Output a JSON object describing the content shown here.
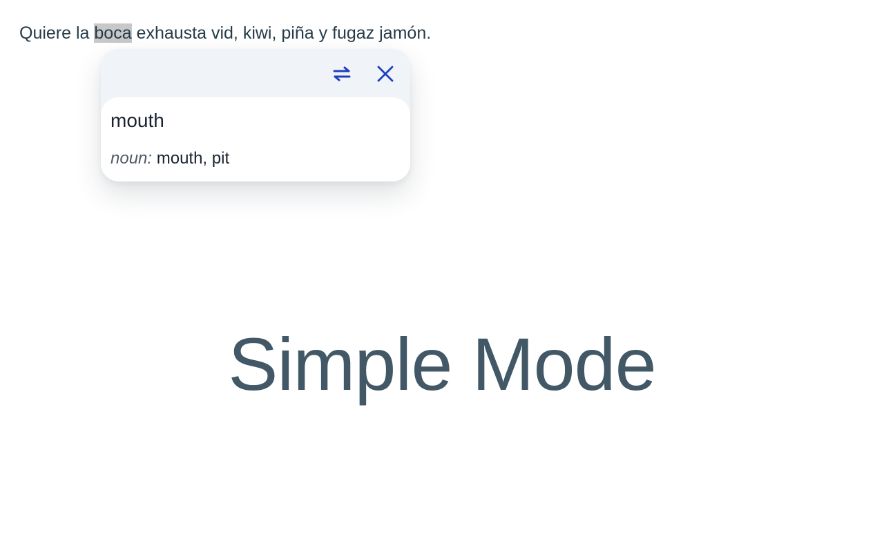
{
  "sentence": {
    "before": "Quiere la ",
    "selected": "boca",
    "after": " exhausta vid, kiwi, piña y fugaz jamón."
  },
  "popup": {
    "toolbar": {
      "swap_icon": "swap-arrows-icon",
      "close_icon": "close-icon",
      "icon_color": "#1f3fbf"
    },
    "translation": "mouth",
    "definition": {
      "part_of_speech": "noun:",
      "meanings": " mouth, pit"
    }
  },
  "mode_title": "Simple Mode",
  "colors": {
    "text": "#263b48",
    "selection": "#c8c8c8",
    "popup_header": "#f0f3f8",
    "mode_title": "#435866"
  }
}
